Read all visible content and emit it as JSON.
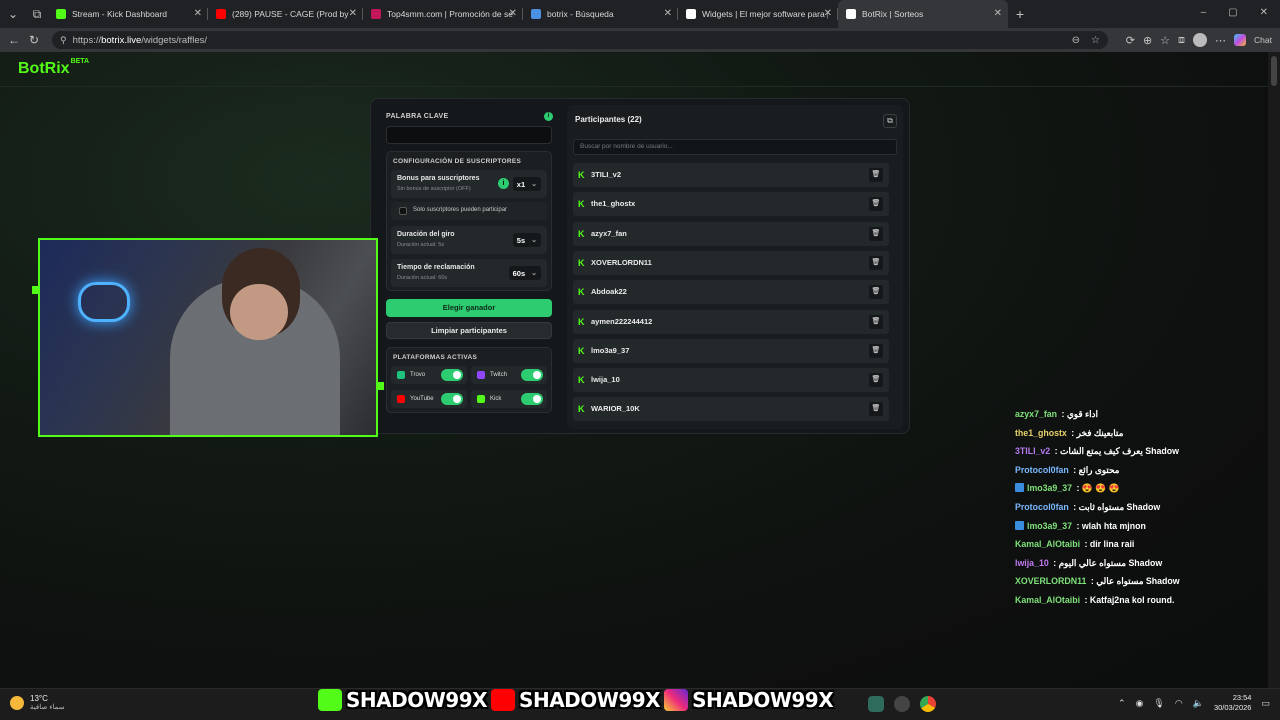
{
  "browser": {
    "tabs": [
      {
        "label": "Stream - Kick Dashboard",
        "icon": "kick-icon",
        "color": "#53fc18"
      },
      {
        "label": "(289) PAUSE - CAGE (Prod by",
        "icon": "youtube-icon",
        "color": "#ff0000"
      },
      {
        "label": "Top4smm.com | Promoción de seg",
        "icon": "top4smm-icon",
        "color": "#c2185b"
      },
      {
        "label": "botrix - Búsqueda",
        "icon": "search-icon",
        "color": "#4a90e2"
      },
      {
        "label": "Widgets | El mejor software para p",
        "icon": "botrix-icon",
        "color": "#ffffff"
      },
      {
        "label": "BotRix | Sorteos",
        "icon": "botrix-icon",
        "color": "#ffffff"
      }
    ],
    "url_prefix": "https://",
    "url_domain": "botrix.live",
    "url_path": "/widgets/raffles/",
    "chat_label": "Chat"
  },
  "app": {
    "brand": "BotRix",
    "brand_sup": "BETA"
  },
  "raffle": {
    "keyword_label": "PALABRA CLAVE",
    "keyword_value": "",
    "sub_config_label": "CONFIGURACIÓN DE SUSCRIPTORES",
    "bonus_title": "Bonus para suscriptores",
    "bonus_sub": "Sin bonus de suscriptor (OFF)",
    "bonus_value": "x1",
    "subs_only_label": "Solo suscriptores pueden participar",
    "spin_title": "Duración del giro",
    "spin_sub": "Duración actual: 5s",
    "spin_value": "5s",
    "claim_title": "Tiempo de reclamación",
    "claim_sub": "Duración actual: 60s",
    "claim_value": "60s",
    "pick_button": "Elegir ganador",
    "clear_button": "Limpiar participantes",
    "platforms_label": "PLATAFORMAS ACTIVAS",
    "platforms": [
      {
        "name": "Trovo",
        "color": "#1ec27a",
        "enabled": true
      },
      {
        "name": "Twitch",
        "color": "#9146ff",
        "enabled": true
      },
      {
        "name": "YouTube",
        "color": "#ff0000",
        "enabled": true
      },
      {
        "name": "Kick",
        "color": "#53fc18",
        "enabled": true
      }
    ]
  },
  "participants": {
    "title": "Participantes (22)",
    "search_placeholder": "Buscar por nombre de usuario...",
    "items": [
      "3TILI_v2",
      "the1_ghostx",
      "azyx7_fan",
      "XOVERLORDN11",
      "Abdoak22",
      "aymen222244412",
      "lmo3a9_37",
      "lwija_10",
      "WARIOR_10K"
    ]
  },
  "chat": [
    {
      "user": "azyx7_fan",
      "color": "#7fe07a",
      "text": "اداء قوي",
      "icon": ""
    },
    {
      "user": "the1_ghostx",
      "color": "#e8d26a",
      "text": "متابعينك فخر",
      "icon": ""
    },
    {
      "user": "3TILI_v2",
      "color": "#b77bf2",
      "text": "يعرف كيف يمتع الشات Shadow",
      "icon": ""
    },
    {
      "user": "Protocol0fan",
      "color": "#7ab8ff",
      "text": "محتوى رائع",
      "icon": ""
    },
    {
      "user": "lmo3a9_37",
      "color": "#7fe07a",
      "text": "😍 😍 😍",
      "icon": "kick-badge-icon"
    },
    {
      "user": "Protocol0fan",
      "color": "#7ab8ff",
      "text": "مستواه ثابت Shadow",
      "icon": ""
    },
    {
      "user": "lmo3a9_37",
      "color": "#7fe07a",
      "text": "wlah hta mjnon",
      "icon": "kick-badge-icon"
    },
    {
      "user": "Kamal_AlOtaibi",
      "color": "#7fe07a",
      "text": "dir lina raii",
      "icon": ""
    },
    {
      "user": "lwija_10",
      "color": "#c27af2",
      "text": "مستواه عالي اليوم Shadow",
      "icon": ""
    },
    {
      "user": "XOVERLORDN11",
      "color": "#7fe07a",
      "text": "مستواه عالي Shadow",
      "icon": ""
    },
    {
      "user": "Kamal_AlOtaibi",
      "color": "#7fe07a",
      "text": "Katfaj2na kol round.",
      "icon": ""
    }
  ],
  "taskbar": {
    "temp": "13°C",
    "weather": "سماء صافية",
    "banner": "SHADOW99X",
    "time": "23:54",
    "date": "30/03/2026"
  }
}
